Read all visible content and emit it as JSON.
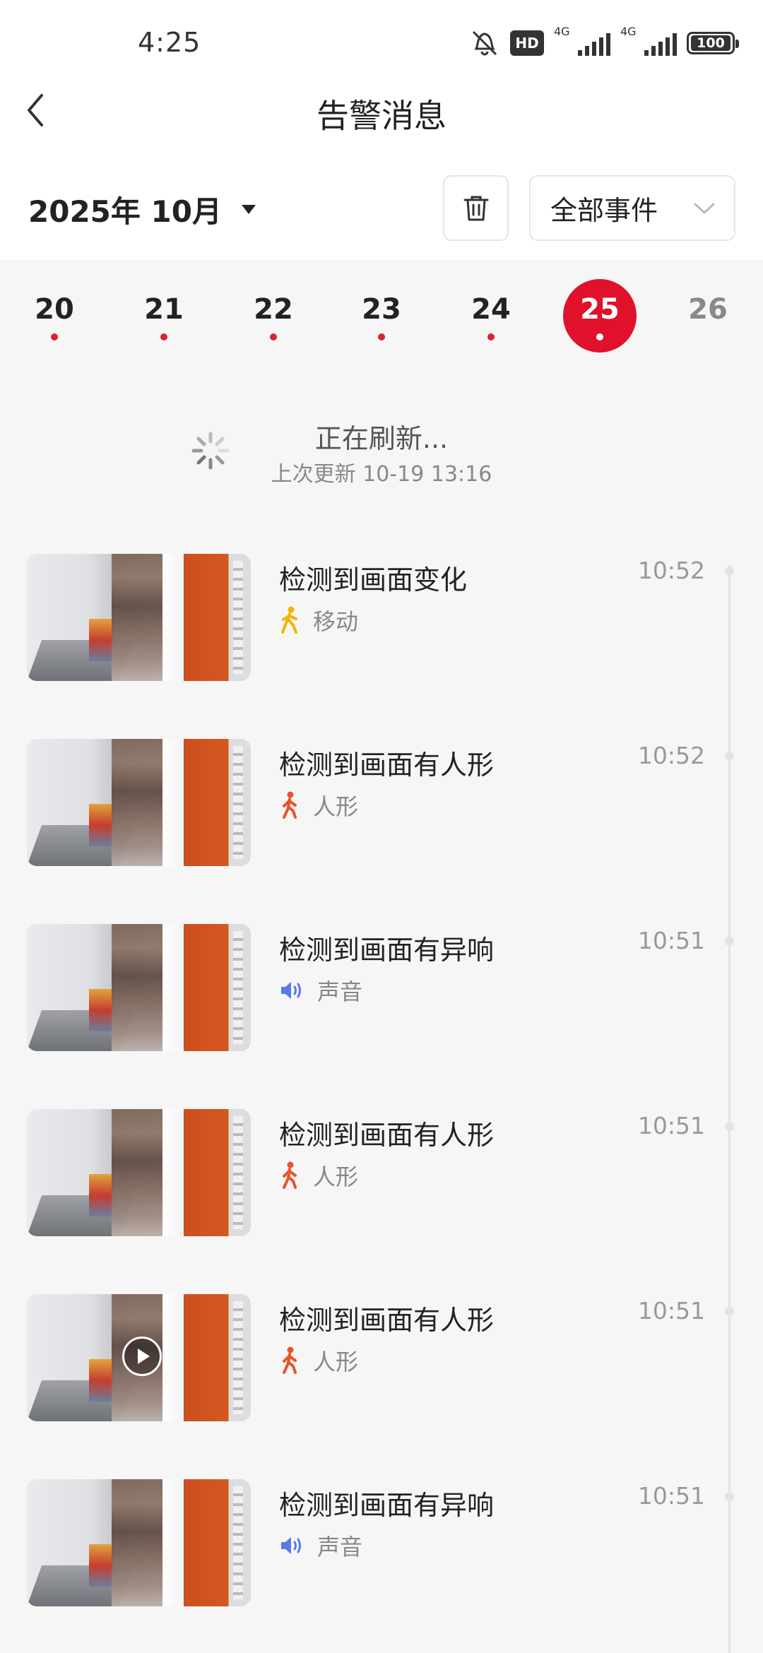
{
  "status_bar": {
    "time": "4:25",
    "hd_badge": "HD",
    "network_1": "4G",
    "network_2": "4G",
    "battery": "100"
  },
  "header": {
    "title": "告警消息"
  },
  "filters": {
    "month_label": "2025年 10月",
    "event_filter_label": "全部事件"
  },
  "dates": [
    {
      "day": "20",
      "has_event": true,
      "selected": false
    },
    {
      "day": "21",
      "has_event": true,
      "selected": false
    },
    {
      "day": "22",
      "has_event": true,
      "selected": false
    },
    {
      "day": "23",
      "has_event": true,
      "selected": false
    },
    {
      "day": "24",
      "has_event": true,
      "selected": false
    },
    {
      "day": "25",
      "has_event": true,
      "selected": true
    },
    {
      "day": "26",
      "has_event": false,
      "selected": false
    }
  ],
  "refresh": {
    "title": "正在刷新...",
    "last_update": "上次更新 10-19 13:16"
  },
  "events": [
    {
      "title": "检测到画面变化",
      "type": "移动",
      "type_icon": "walking-person-icon",
      "icon_color": "#f2b400",
      "time": "10:52",
      "show_play": false
    },
    {
      "title": "检测到画面有人形",
      "type": "人形",
      "type_icon": "person-icon",
      "icon_color": "#e8542b",
      "time": "10:52",
      "show_play": false
    },
    {
      "title": "检测到画面有异响",
      "type": "声音",
      "type_icon": "speaker-icon",
      "icon_color": "#5a78e6",
      "time": "10:51",
      "show_play": false
    },
    {
      "title": "检测到画面有人形",
      "type": "人形",
      "type_icon": "person-icon",
      "icon_color": "#e8542b",
      "time": "10:51",
      "show_play": false
    },
    {
      "title": "检测到画面有人形",
      "type": "人形",
      "type_icon": "person-icon",
      "icon_color": "#e8542b",
      "time": "10:51",
      "show_play": true
    },
    {
      "title": "检测到画面有异响",
      "type": "声音",
      "type_icon": "speaker-icon",
      "icon_color": "#5a78e6",
      "time": "10:51",
      "show_play": false
    }
  ],
  "colors": {
    "accent": "#e0122b",
    "event_dot": "#d9232e"
  }
}
